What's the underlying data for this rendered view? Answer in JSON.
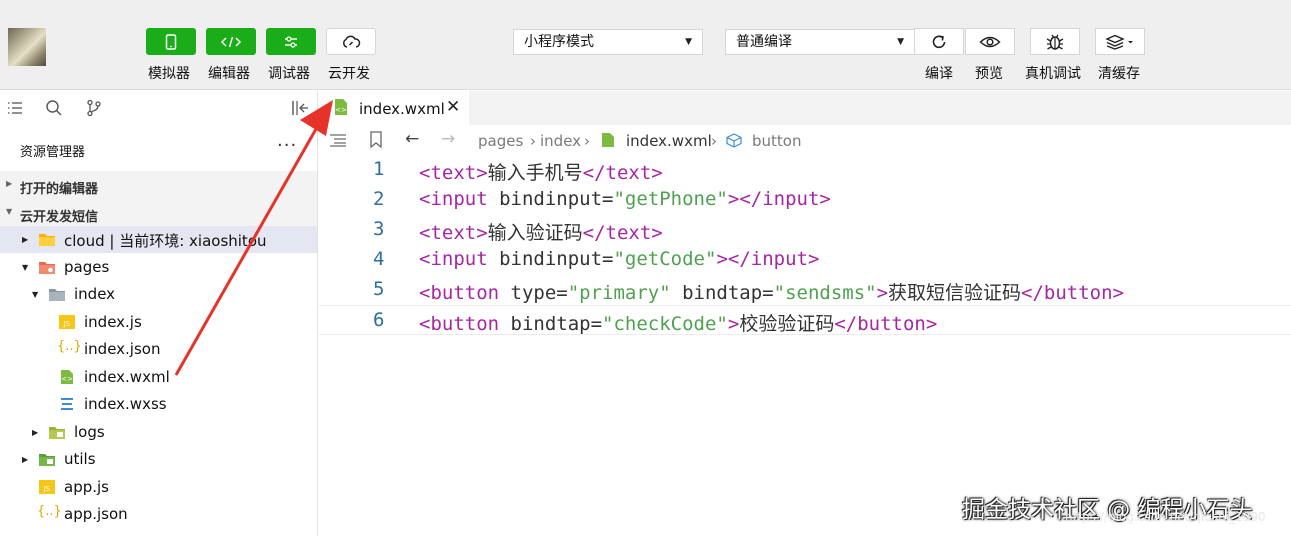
{
  "toolbar": {
    "buttons": [
      {
        "label": "模拟器",
        "icon": "phone-icon"
      },
      {
        "label": "编辑器",
        "icon": "code-icon"
      },
      {
        "label": "调试器",
        "icon": "sliders-icon"
      },
      {
        "label": "云开发",
        "icon": "cloud-icon"
      }
    ],
    "mode_select": {
      "value": "小程序模式",
      "icon": "caret-down-icon"
    },
    "compile_select": {
      "value": "普通编译",
      "icon": "caret-down-icon"
    },
    "actions": [
      {
        "label": "编译",
        "icon": "refresh-icon"
      },
      {
        "label": "预览",
        "icon": "eye-icon"
      },
      {
        "label": "真机调试",
        "icon": "bug-icon"
      },
      {
        "label": "清缓存",
        "icon": "layers-icon"
      }
    ]
  },
  "sidebar": {
    "explorer_title": "资源管理器",
    "more": "···",
    "open_editors": "打开的编辑器",
    "project": "云开发发短信",
    "tree": [
      {
        "label": "cloud | 当前环境: xiaoshitou",
        "icon": "cloud-folder-icon"
      },
      {
        "label": "pages",
        "icon": "folder-icon"
      },
      {
        "label": "index",
        "icon": "folder-icon"
      },
      {
        "label": "index.js",
        "icon": "js-file-icon"
      },
      {
        "label": "index.json",
        "icon": "json-file-icon"
      },
      {
        "label": "index.wxml",
        "icon": "wxml-file-icon"
      },
      {
        "label": "index.wxss",
        "icon": "wxss-file-icon"
      },
      {
        "label": "logs",
        "icon": "folder-icon"
      },
      {
        "label": "utils",
        "icon": "folder-icon"
      },
      {
        "label": "app.js",
        "icon": "js-file-icon"
      },
      {
        "label": "app.json",
        "icon": "json-file-icon"
      }
    ]
  },
  "editor": {
    "tab": {
      "label": "index.wxml"
    },
    "breadcrumb": [
      "pages",
      "index",
      "index.wxml",
      "button"
    ],
    "lines": [
      {
        "num": "1",
        "parts": [
          [
            "t",
            "<text>"
          ],
          [
            "c",
            "输入手机号"
          ],
          [
            "t",
            "</text>"
          ]
        ]
      },
      {
        "num": "2",
        "parts": [
          [
            "t",
            "<input"
          ],
          [
            "a",
            " bindinput="
          ],
          [
            "s",
            "\"getPhone\""
          ],
          [
            "t",
            "></input>"
          ]
        ]
      },
      {
        "num": "3",
        "parts": [
          [
            "t",
            "<text>"
          ],
          [
            "c",
            "输入验证码"
          ],
          [
            "t",
            "</text>"
          ]
        ]
      },
      {
        "num": "4",
        "parts": [
          [
            "t",
            "<input"
          ],
          [
            "a",
            " bindinput="
          ],
          [
            "s",
            "\"getCode\""
          ],
          [
            "t",
            "></input>"
          ]
        ]
      },
      {
        "num": "5",
        "parts": [
          [
            "t",
            "<button"
          ],
          [
            "a",
            " type="
          ],
          [
            "s",
            "\"primary\""
          ],
          [
            "a",
            " bindtap="
          ],
          [
            "s",
            "\"sendsms\""
          ],
          [
            "t",
            ">"
          ],
          [
            "c",
            "获取短信验证码"
          ],
          [
            "t",
            "</button>"
          ]
        ]
      },
      {
        "num": "6",
        "parts": [
          [
            "t",
            "<button"
          ],
          [
            "a",
            " bindtap="
          ],
          [
            "s",
            "\"checkCode\""
          ],
          [
            "t",
            ">"
          ],
          [
            "c",
            "校验验证码"
          ],
          [
            "t",
            "</button>"
          ]
        ]
      }
    ]
  },
  "watermark": {
    "text": "掘金技术社区 @ 编程小石头",
    "url": "https://blog.csdn.net/qiushi_1990"
  },
  "colors": {
    "green": "#1aad19",
    "tag": "#a626a4",
    "string": "#50a14f",
    "line_number": "#2e6f9e",
    "annotation_arrow": "#e5332a"
  }
}
